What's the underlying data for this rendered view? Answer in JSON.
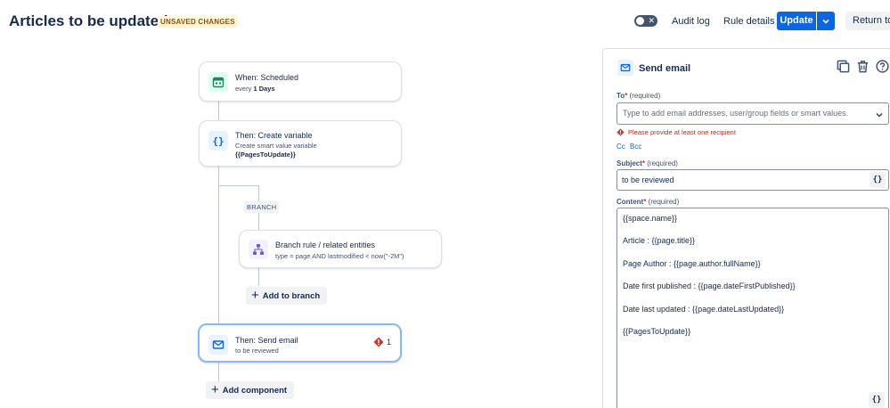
{
  "header": {
    "title": "Articles to be updated",
    "unsaved_badge": "UNSAVED CHANGES",
    "audit_log": "Audit log",
    "rule_details": "Rule details",
    "update_label": "Update",
    "return_label": "Return to r"
  },
  "flow": {
    "trigger": {
      "title": "When: Scheduled",
      "sub_prefix": "every ",
      "sub_value": "1 Days"
    },
    "create_variable": {
      "title": "Then: Create variable",
      "sub": "Create smart value variable",
      "sub_value": "{{PagesToUpdate}}"
    },
    "branch_label": "BRANCH",
    "branch_rule": {
      "title": "Branch rule / related entities",
      "sub": "type = page AND lastmodified < now(\"-2M\")"
    },
    "add_to_branch": "Add to branch",
    "send_email": {
      "title": "Then: Send email",
      "sub": "to be reviewed",
      "error_count": "1"
    },
    "add_component": "Add component"
  },
  "panel": {
    "title": "Send email",
    "to_label": "To",
    "to_required": "(required)",
    "to_placeholder": "Type to add email addresses, user/group fields or smart values.",
    "to_error": "Please provide at least one recipient",
    "cc": "Cc",
    "bcc": "Bcc",
    "subject_label": "Subject",
    "subject_required": "(required)",
    "subject_value": "to be reviewed",
    "content_label": "Content",
    "content_required": "(required)",
    "smart_values_button": "{}",
    "content_lines": [
      "{{space.name}}",
      "Article : {{page.title}}",
      "Page Author : {{page.author.fullName}}",
      "Date first published : {{page.dateFirstPublished}}",
      "Date last updated : {{page.dateLastUpdated}}",
      "{{PagesToUpdate}}"
    ]
  },
  "colors": {
    "primary": "#0c66e4",
    "error": "#c9372c",
    "trigger_icon_bg": "#dcfff1",
    "action_icon_bg": "#e9f2ff",
    "branch_icon_bg": "#f3f0ff"
  }
}
